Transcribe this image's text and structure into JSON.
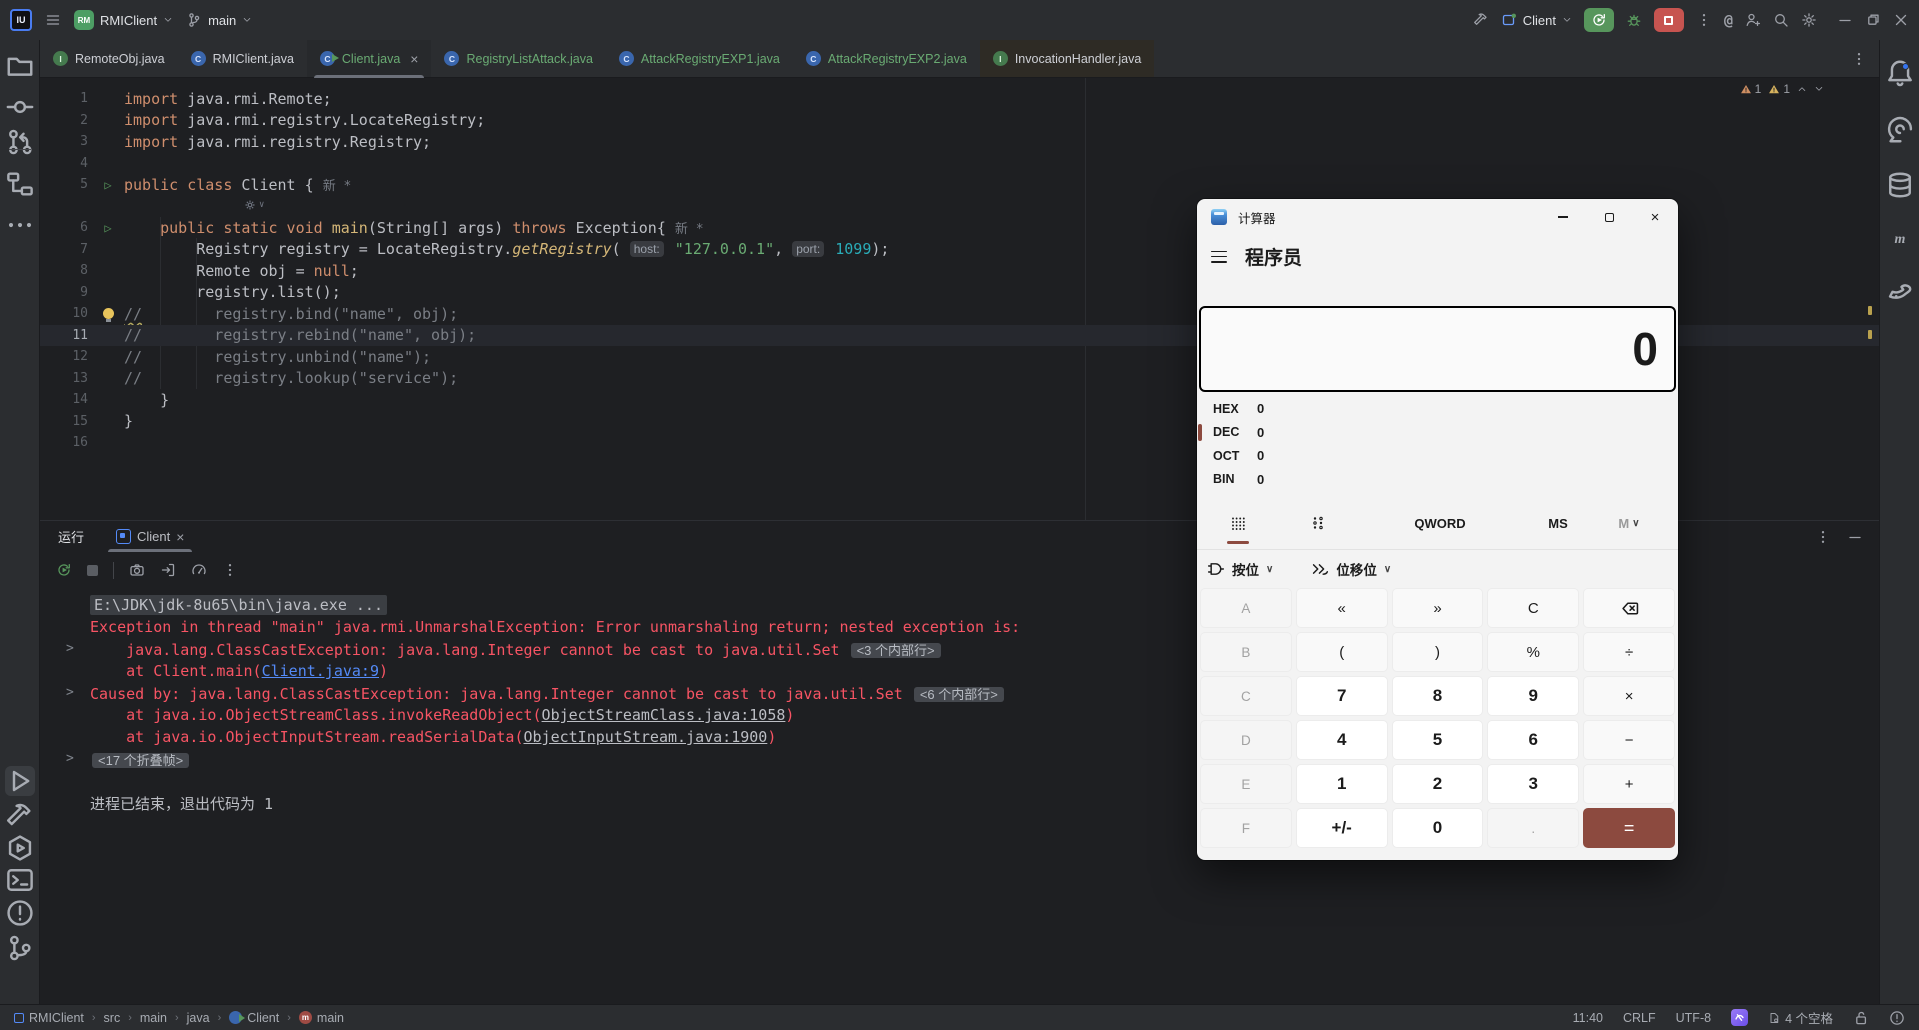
{
  "titlebar": {
    "project": "RMIClient",
    "branch": "main",
    "run_config": "Client"
  },
  "tabbar": {
    "tabs": [
      {
        "label": "RemoteObj.java",
        "icon": "interface",
        "status": "normal"
      },
      {
        "label": "RMIClient.java",
        "icon": "class",
        "status": "normal"
      },
      {
        "label": "Client.java",
        "icon": "class-run",
        "status": "added",
        "active": true
      },
      {
        "label": "RegistryListAttack.java",
        "icon": "class",
        "status": "added"
      },
      {
        "label": "AttackRegistryEXP1.java",
        "icon": "class",
        "status": "added"
      },
      {
        "label": "AttackRegistryEXP2.java",
        "icon": "class",
        "status": "added"
      },
      {
        "label": "InvocationHandler.java",
        "icon": "interface",
        "status": "normal",
        "tinted": true
      }
    ]
  },
  "editor": {
    "inspections": {
      "warnings_1": "1",
      "warnings_2": "1"
    },
    "lines": [
      {
        "n": "1",
        "g": "",
        "t": [
          [
            "k",
            "import"
          ],
          [
            "d",
            " java.rmi.Remote;"
          ]
        ]
      },
      {
        "n": "2",
        "g": "",
        "t": [
          [
            "k",
            "import"
          ],
          [
            "d",
            " java.rmi.registry.LocateRegistry;"
          ]
        ]
      },
      {
        "n": "3",
        "g": "",
        "t": [
          [
            "k",
            "import"
          ],
          [
            "d",
            " java.rmi.registry.Registry;"
          ]
        ]
      },
      {
        "n": "4",
        "g": "",
        "t": []
      },
      {
        "n": "5",
        "g": "run",
        "t": [
          [
            "k",
            "public class "
          ],
          [
            "d",
            "Client { "
          ],
          [
            "cv",
            "新 *"
          ]
        ]
      },
      {
        "type": "inlay"
      },
      {
        "n": "6",
        "g": "run",
        "t": [
          [
            "d",
            "    "
          ],
          [
            "k",
            "public static void "
          ],
          [
            "m",
            "main"
          ],
          [
            "d",
            "(String[] args) "
          ],
          [
            "k",
            "throws "
          ],
          [
            "d",
            "Exception{ "
          ],
          [
            "cv",
            "新 *"
          ]
        ]
      },
      {
        "n": "7",
        "g": "",
        "t": [
          [
            "d",
            "        Registry registry = LocateRegistry."
          ],
          [
            "mi",
            "getRegistry"
          ],
          [
            "d",
            "( "
          ],
          [
            "h",
            "host:"
          ],
          [
            "s",
            " \"127.0.0.1\""
          ],
          [
            "d",
            ", "
          ],
          [
            "h",
            "port:"
          ],
          [
            "n",
            " 1099"
          ],
          [
            "d",
            ");"
          ]
        ]
      },
      {
        "n": "8",
        "g": "",
        "t": [
          [
            "d",
            "        Remote obj = "
          ],
          [
            "k",
            "null"
          ],
          [
            "d",
            ";"
          ]
        ]
      },
      {
        "n": "9",
        "g": "",
        "t": [
          [
            "d",
            "        registry.list();"
          ]
        ]
      },
      {
        "n": "10",
        "g": "bulb",
        "t": [
          [
            "cw",
            "//"
          ],
          [
            "c",
            "        registry.bind(\"name\", obj);"
          ]
        ]
      },
      {
        "n": "11",
        "g": "",
        "active": true,
        "t": [
          [
            "c",
            "//        registry.rebind(\"name\", obj);"
          ]
        ]
      },
      {
        "n": "12",
        "g": "",
        "t": [
          [
            "c",
            "//        registry.unbind(\"name\");"
          ]
        ]
      },
      {
        "n": "13",
        "g": "",
        "t": [
          [
            "c",
            "//        registry.lookup(\"service\");"
          ]
        ]
      },
      {
        "n": "14",
        "g": "",
        "t": [
          [
            "d",
            "    }"
          ]
        ]
      },
      {
        "n": "15",
        "g": "",
        "t": [
          [
            "d",
            "}"
          ]
        ]
      },
      {
        "n": "16",
        "g": "",
        "t": []
      }
    ]
  },
  "run_panel": {
    "title": "运行",
    "tab": "Client",
    "console": [
      {
        "t": [
          [
            "chip",
            "E:\\JDK\\jdk-8u65\\bin\\java.exe ..."
          ]
        ]
      },
      {
        "t": [
          [
            "err",
            "Exception in thread \"main\" java.rmi.UnmarshalException: Error unmarshaling return; nested exception is: "
          ]
        ]
      },
      {
        "fold": true,
        "t": [
          [
            "err",
            "    java.lang.ClassCastException: java.lang.Integer cannot be cast to java.util.Set "
          ],
          [
            "badge",
            "<3 个内部行>"
          ]
        ]
      },
      {
        "t": [
          [
            "err",
            "    at Client.main("
          ],
          [
            "lnk",
            "Client.java:9"
          ],
          [
            "err",
            ")"
          ]
        ]
      },
      {
        "fold": true,
        "t": [
          [
            "err",
            "Caused by: java.lang.ClassCastException: java.lang.Integer cannot be cast to java.util.Set "
          ],
          [
            "badge",
            "<6 个内部行>"
          ]
        ]
      },
      {
        "t": [
          [
            "err",
            "    at java.io.ObjectStreamClass.invokeReadObject("
          ],
          [
            "glnk",
            "ObjectStreamClass.java:1058"
          ],
          [
            "err",
            ")"
          ]
        ]
      },
      {
        "t": [
          [
            "err",
            "    at java.io.ObjectInputStream.readSerialData("
          ],
          [
            "glnk",
            "ObjectInputStream.java:1900"
          ],
          [
            "err",
            ")"
          ]
        ]
      },
      {
        "fold": true,
        "t": [
          [
            "badge",
            "<17 个折叠帧>"
          ]
        ]
      },
      {
        "t": []
      },
      {
        "t": [
          [
            "plain",
            "进程已结束，退出代码为 1"
          ]
        ]
      }
    ]
  },
  "rails": {
    "left_top": [
      "folder",
      "commit",
      "pull-request",
      "divider",
      "structure",
      "more"
    ],
    "left_bottom": [
      "play",
      "hammer",
      "services",
      "terminal",
      "problems",
      "git-branch"
    ],
    "right": [
      "bell",
      "ai-chat",
      "database",
      "maven",
      "gradle"
    ]
  },
  "statusbar": {
    "breadcrumbs": [
      {
        "icon": "module",
        "label": "RMIClient"
      },
      {
        "label": "src"
      },
      {
        "label": "main"
      },
      {
        "label": "java"
      },
      {
        "icon": "class-run",
        "label": "Client"
      },
      {
        "icon": "method",
        "label": "main"
      }
    ],
    "time": "11:40",
    "line_ending": "CRLF",
    "encoding": "UTF-8",
    "indent": "4 个空格"
  },
  "calculator": {
    "title": "计算器",
    "mode": "程序员",
    "display": "0",
    "radix": [
      {
        "label": "HEX",
        "value": "0",
        "name": "hex"
      },
      {
        "label": "DEC",
        "value": "0",
        "name": "dec",
        "active": true
      },
      {
        "label": "OCT",
        "value": "0",
        "name": "oct"
      },
      {
        "label": "BIN",
        "value": "0",
        "name": "bin"
      }
    ],
    "word_size": "QWORD",
    "memory_store": "MS",
    "memory_menu": "M",
    "bitwise": "按位",
    "bitshift": "位移位",
    "keys": [
      [
        {
          "l": "A",
          "k": "dis",
          "n": "hex-a"
        },
        {
          "l": "«",
          "k": "op",
          "n": "left-shift"
        },
        {
          "l": "»",
          "k": "op",
          "n": "right-shift"
        },
        {
          "l": "C",
          "k": "op",
          "n": "clear"
        },
        {
          "icon": "backspace",
          "k": "op",
          "n": "backspace"
        }
      ],
      [
        {
          "l": "B",
          "k": "dis",
          "n": "hex-b"
        },
        {
          "l": "(",
          "k": "op",
          "n": "open-paren"
        },
        {
          "l": ")",
          "k": "op",
          "n": "close-paren"
        },
        {
          "l": "%",
          "k": "op",
          "n": "percent"
        },
        {
          "l": "÷",
          "k": "op",
          "n": "divide"
        }
      ],
      [
        {
          "l": "C",
          "k": "dis",
          "n": "hex-c"
        },
        {
          "l": "7",
          "k": "num",
          "n": "7"
        },
        {
          "l": "8",
          "k": "num",
          "n": "8"
        },
        {
          "l": "9",
          "k": "num",
          "n": "9"
        },
        {
          "l": "×",
          "k": "op",
          "n": "multiply"
        }
      ],
      [
        {
          "l": "D",
          "k": "dis",
          "n": "hex-d"
        },
        {
          "l": "4",
          "k": "num",
          "n": "4"
        },
        {
          "l": "5",
          "k": "num",
          "n": "5"
        },
        {
          "l": "6",
          "k": "num",
          "n": "6"
        },
        {
          "l": "−",
          "k": "op",
          "n": "subtract"
        }
      ],
      [
        {
          "l": "E",
          "k": "dis",
          "n": "hex-e"
        },
        {
          "l": "1",
          "k": "num",
          "n": "1"
        },
        {
          "l": "2",
          "k": "num",
          "n": "2"
        },
        {
          "l": "3",
          "k": "num",
          "n": "3"
        },
        {
          "l": "+",
          "k": "op",
          "n": "add"
        }
      ],
      [
        {
          "l": "F",
          "k": "dis",
          "n": "hex-f"
        },
        {
          "l": "+/-",
          "k": "num",
          "n": "negate"
        },
        {
          "l": "0",
          "k": "num",
          "n": "0"
        },
        {
          "l": ".",
          "k": "dis",
          "n": "decimal"
        },
        {
          "l": "=",
          "k": "e",
          "n": "equals"
        }
      ]
    ]
  }
}
